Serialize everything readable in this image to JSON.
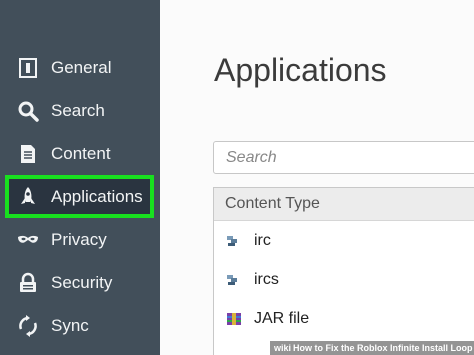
{
  "sidebar": {
    "items": [
      {
        "label": "General",
        "icon": "general-icon"
      },
      {
        "label": "Search",
        "icon": "search-icon"
      },
      {
        "label": "Content",
        "icon": "document-icon"
      },
      {
        "label": "Applications",
        "icon": "rocket-icon",
        "active": true
      },
      {
        "label": "Privacy",
        "icon": "mask-icon"
      },
      {
        "label": "Security",
        "icon": "lock-icon"
      },
      {
        "label": "Sync",
        "icon": "sync-icon"
      }
    ],
    "highlight_color": "#18e01f",
    "background": "#424f5a"
  },
  "main": {
    "title": "Applications",
    "search_placeholder": "Search",
    "table": {
      "header": "Content Type",
      "rows": [
        {
          "label": "irc",
          "icon": "chat-icon"
        },
        {
          "label": "ircs",
          "icon": "chat-icon"
        },
        {
          "label": "JAR file",
          "icon": "archive-icon"
        }
      ]
    }
  },
  "watermark": {
    "brand": "wiki",
    "brand_suffix": "How",
    "text": "to Fix the Roblox Infinite Install Loop"
  }
}
